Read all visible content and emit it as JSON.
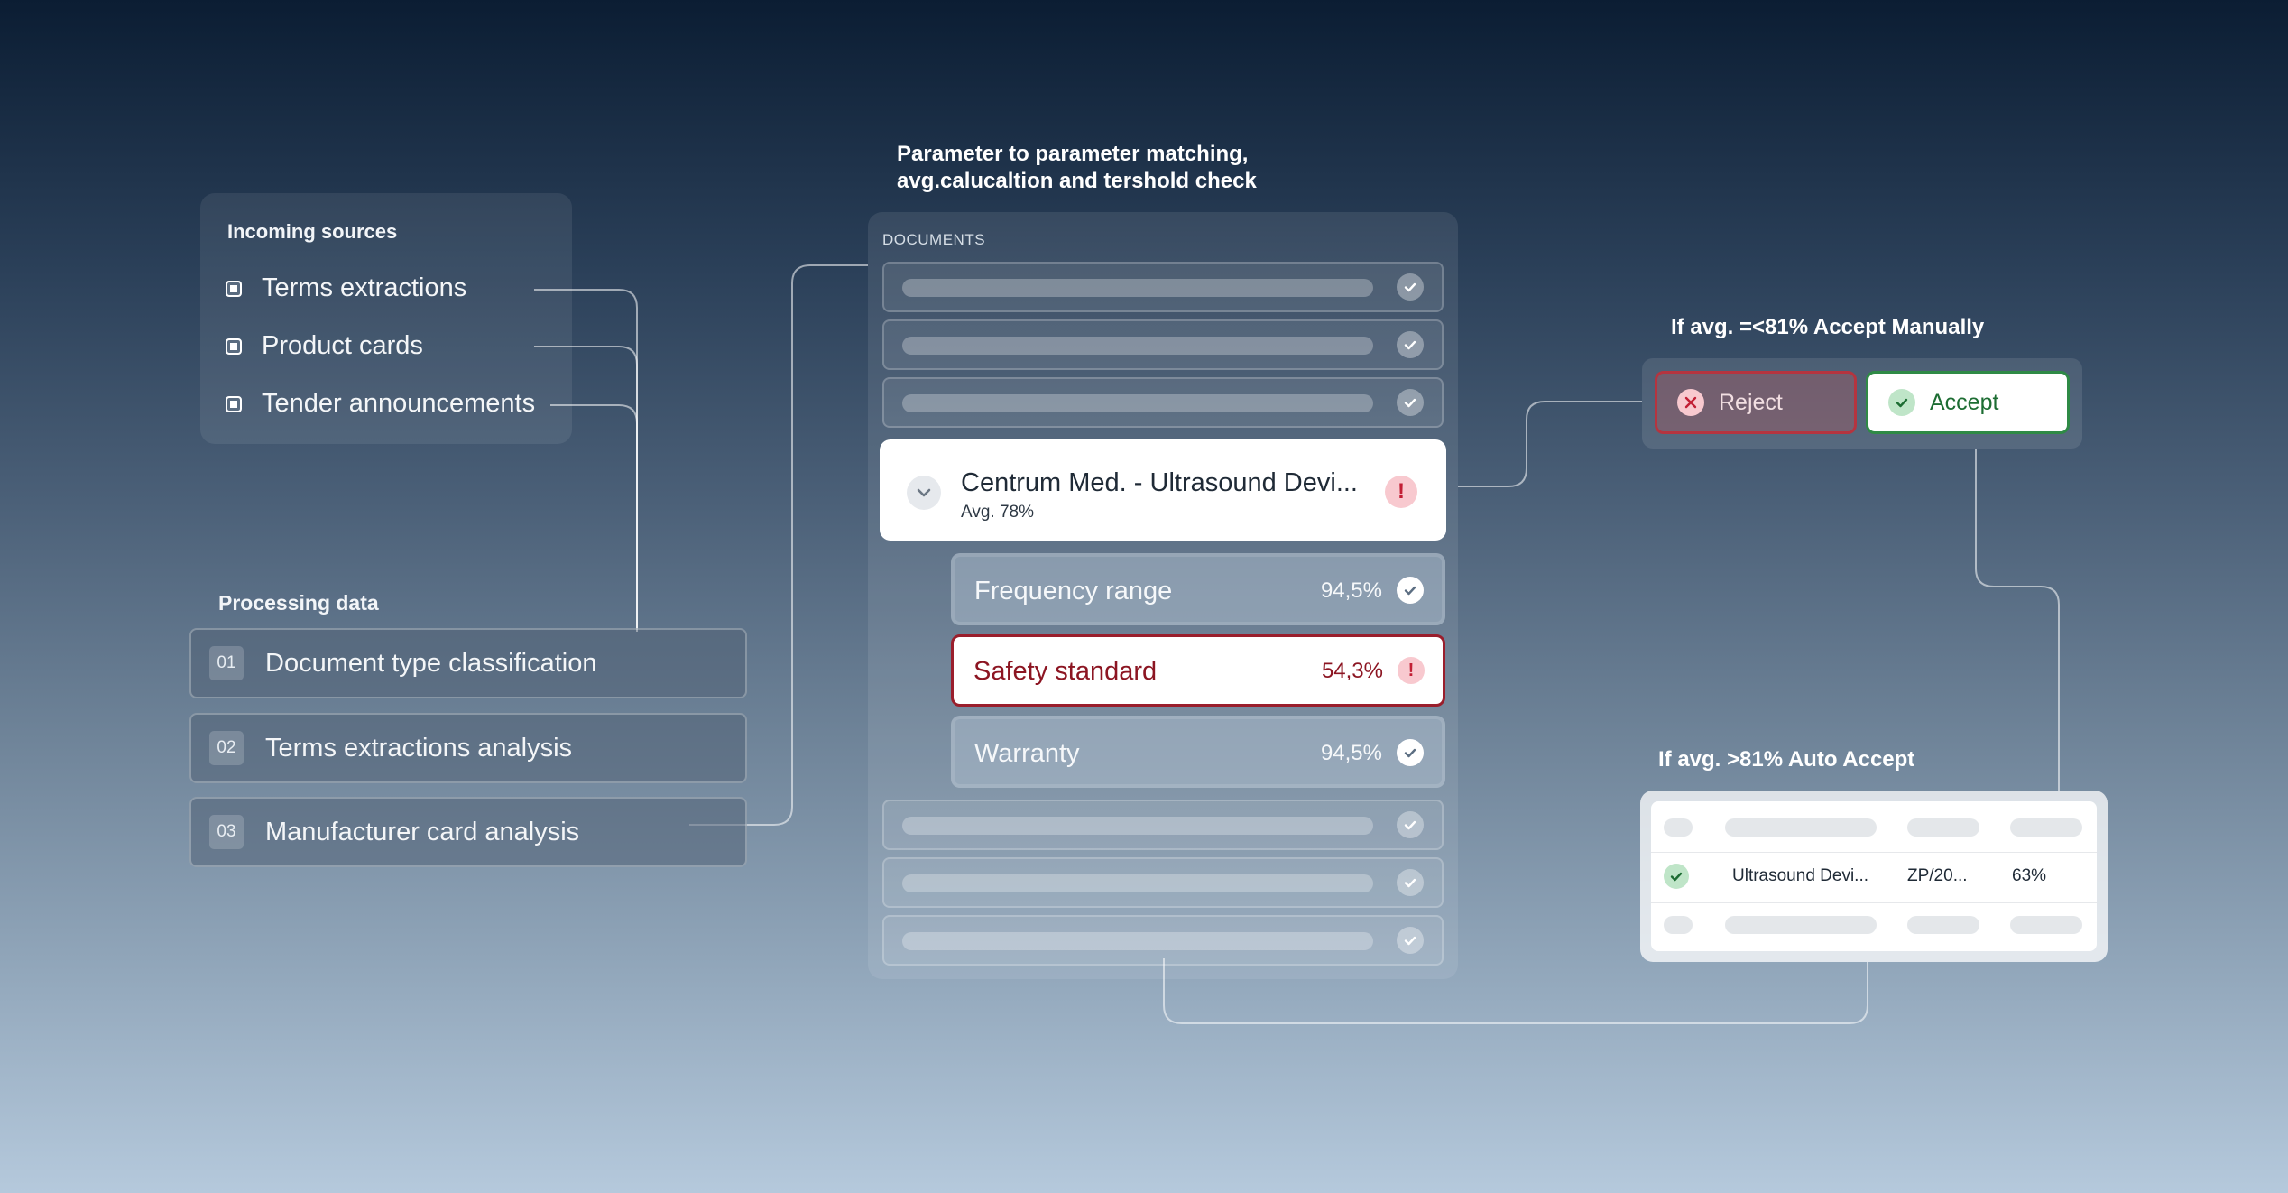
{
  "sources": {
    "title": "Incoming sources",
    "items": [
      "Terms extractions",
      "Product cards",
      "Tender announcements"
    ]
  },
  "processing": {
    "title": "Processing data",
    "steps": [
      {
        "num": "01",
        "label": "Document type classification"
      },
      {
        "num": "02",
        "label": "Terms extractions analysis"
      },
      {
        "num": "03",
        "label": "Manufacturer card analysis"
      }
    ]
  },
  "matching": {
    "heading_line1": "Parameter to parameter matching,",
    "heading_line2": "avg.calucaltion and tershold check",
    "documents_label": "DOCUMENTS",
    "doc": {
      "title": "Centrum Med. - Ultrasound Devi...",
      "avg": "Avg. 78%",
      "alert": "!"
    },
    "params": [
      {
        "label": "Frequency range",
        "pct": "94,5%",
        "status": "ok"
      },
      {
        "label": "Safety standard",
        "pct": "54,3%",
        "status": "alert"
      },
      {
        "label": "Warranty",
        "pct": "94,5%",
        "status": "ok"
      }
    ]
  },
  "manual": {
    "title": "If avg. =<81% Accept Manually",
    "reject": "Reject",
    "accept": "Accept"
  },
  "auto": {
    "title": "If avg. >81% Auto Accept",
    "row": {
      "name": "Ultrasound Devi...",
      "ref": "ZP/20...",
      "pct": "63%"
    }
  },
  "colors": {
    "alert": "#9a1e2c",
    "success": "#2f8a46",
    "reject_icon": "#c21f35"
  }
}
